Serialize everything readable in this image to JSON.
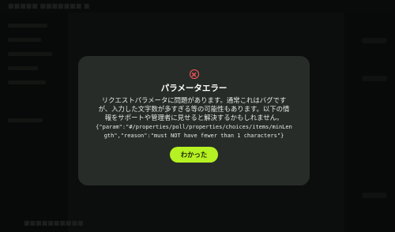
{
  "background": {
    "top_text": "■■■■■ ■■■■■■■ ■",
    "compose_placeholder": "■■■■■■■■■■■■■■■■",
    "side_text": "■■■■■",
    "bottom_text": "■■■■■■■■■■"
  },
  "dialog": {
    "title": "パラメータエラー",
    "message_lines": [
      "リクエストパラメータに問題があります。通常これはバグです",
      "が、入力した文字数が多すぎる等の可能性もあります。以下の情",
      "報をサポートや管理者に見せると解決するかもしれません。"
    ],
    "json_lines": [
      "{\"param\":\"#/properties/poll/properties/choices/items/minLen",
      "gth\",\"reason\":\"must NOT have fewer than 1 characters\"}"
    ],
    "ok_label": "わかった",
    "icon": "error-x-icon"
  },
  "colors": {
    "accent": "#b5f123",
    "error": "#ff5a5f",
    "dialog_bg": "#272c28"
  }
}
